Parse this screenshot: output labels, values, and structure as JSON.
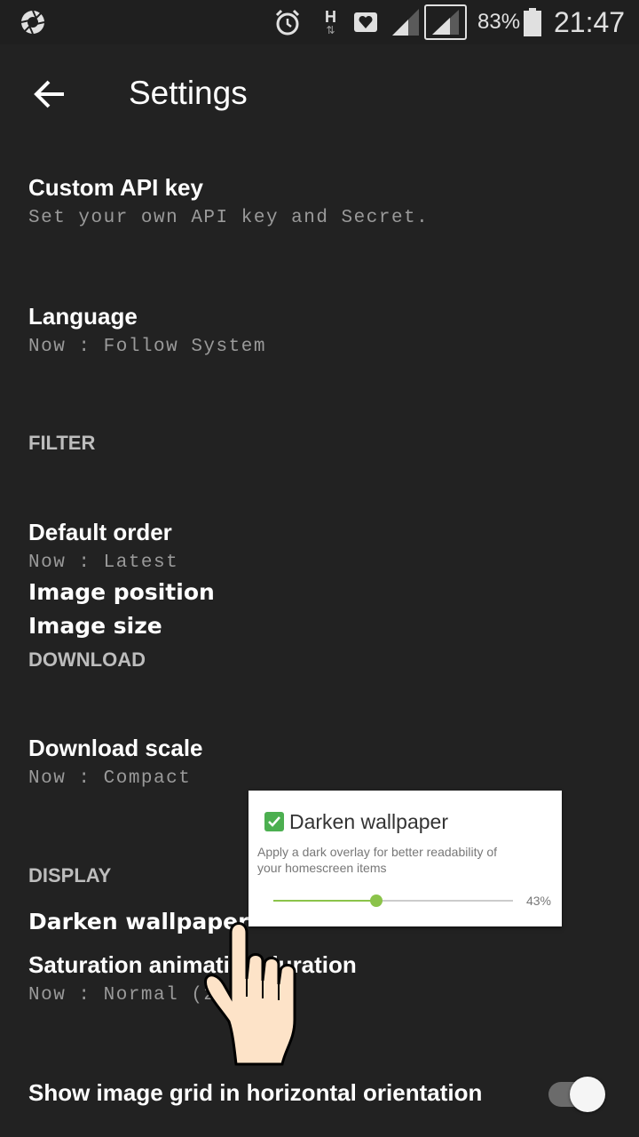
{
  "status_bar": {
    "battery": "83%",
    "time": "21:47",
    "network_letter": "H",
    "icons": [
      "shutter-icon",
      "alarm-icon",
      "data-arrows-icon",
      "heart-notification-icon",
      "signal-icon",
      "signal-icon-outlined",
      "battery-icon"
    ]
  },
  "app_bar": {
    "title": "Settings",
    "back_icon": "arrow-back-icon"
  },
  "items": {
    "custom_api": {
      "title": "Custom API key",
      "subtitle": "Set your own API key and Secret."
    },
    "language": {
      "title": "Language",
      "subtitle": "Now : Follow System"
    },
    "filter_header": "FILTER",
    "default_order": {
      "title": "Default order",
      "subtitle": "Now : Latest"
    },
    "image_position": "Image position",
    "image_size": "Image size",
    "download_header": "DOWNLOAD",
    "download_scale": {
      "title": "Download scale",
      "subtitle": "Now : Compact"
    },
    "display_header": "DISPLAY",
    "darken_wallpaper": "Darken wallpaper",
    "saturation_animation": {
      "title": "Saturation animation duration",
      "subtitle": "Now : Normal (2"
    },
    "show_grid": {
      "title": "Show image grid in horizontal orientation",
      "enabled": true
    }
  },
  "popup": {
    "title": "Darken wallpaper",
    "checked": true,
    "description": "Apply a dark overlay for better readability of your homescreen items",
    "value": 0.43,
    "value_label": "43%"
  },
  "overlay": {
    "icon": "pointing-hand-icon"
  },
  "colors": {
    "background": "#222222",
    "accent": "#8bc34a",
    "checkbox": "#4caf50"
  }
}
